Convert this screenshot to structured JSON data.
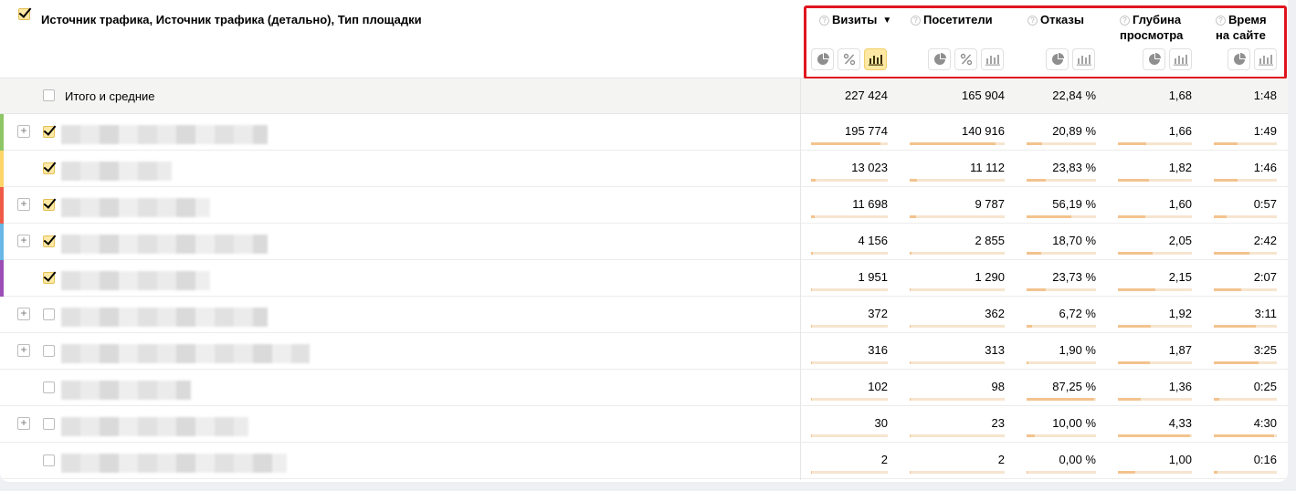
{
  "header": {
    "dimensions_title": "Источник трафика, Источник трафика (детально), Тип площадки",
    "metrics": [
      {
        "name": "Визиты",
        "line2": "",
        "sorted": true,
        "sort_arrow": "▼",
        "buttons": [
          "pie-chart-icon",
          "percent-icon",
          "bar-chart-icon"
        ],
        "active_button": "bar-chart-icon"
      },
      {
        "name": "Посетители",
        "line2": "",
        "sorted": false,
        "buttons": [
          "pie-chart-icon",
          "percent-icon",
          "bar-chart-icon"
        ]
      },
      {
        "name": "Отказы",
        "line2": "",
        "sorted": false,
        "buttons": [
          "pie-chart-icon",
          "bar-chart-icon"
        ]
      },
      {
        "name": "Глубина",
        "line2": "просмотра",
        "sorted": false,
        "buttons": [
          "pie-chart-icon",
          "bar-chart-icon"
        ]
      },
      {
        "name": "Время",
        "line2": "на сайте",
        "sorted": false,
        "buttons": [
          "pie-chart-icon",
          "bar-chart-icon"
        ]
      }
    ],
    "help_glyph": "?"
  },
  "totals": {
    "label": "Итого и средние",
    "values": [
      "227 424",
      "165 904",
      "22,84 %",
      "1,68",
      "1:48"
    ]
  },
  "rows": [
    {
      "color": "#8cc665",
      "expandable": true,
      "checked": true,
      "values": [
        "195 774",
        "140 916",
        "20,89 %",
        "1,66",
        "1:49"
      ],
      "bars": [
        0.9,
        0.9,
        0.22,
        0.38,
        0.38
      ]
    },
    {
      "color": "#fbd567",
      "expandable": false,
      "checked": true,
      "values": [
        "13 023",
        "11 112",
        "23,83 %",
        "1,82",
        "1:46"
      ],
      "bars": [
        0.06,
        0.08,
        0.27,
        0.42,
        0.37
      ]
    },
    {
      "color": "#ef5b46",
      "expandable": true,
      "checked": true,
      "values": [
        "11 698",
        "9 787",
        "56,19 %",
        "1,60",
        "0:57"
      ],
      "bars": [
        0.05,
        0.07,
        0.64,
        0.37,
        0.2
      ]
    },
    {
      "color": "#68b7e6",
      "expandable": true,
      "checked": true,
      "values": [
        "4 156",
        "2 855",
        "18,70 %",
        "2,05",
        "2:42"
      ],
      "bars": [
        0.02,
        0.02,
        0.21,
        0.47,
        0.56
      ]
    },
    {
      "color": "#9b4fb5",
      "expandable": false,
      "checked": true,
      "values": [
        "1 951",
        "1 290",
        "23,73 %",
        "2,15",
        "2:07"
      ],
      "bars": [
        0.01,
        0.01,
        0.27,
        0.5,
        0.44
      ]
    },
    {
      "color": "",
      "expandable": true,
      "checked": false,
      "values": [
        "372",
        "362",
        "6,72 %",
        "1,92",
        "3:11"
      ],
      "bars": [
        0.005,
        0.005,
        0.08,
        0.44,
        0.66
      ]
    },
    {
      "color": "",
      "expandable": true,
      "checked": false,
      "values": [
        "316",
        "313",
        "1,90 %",
        "1,87",
        "3:25"
      ],
      "bars": [
        0.005,
        0.005,
        0.03,
        0.43,
        0.71
      ]
    },
    {
      "color": "",
      "expandable": false,
      "checked": false,
      "values": [
        "102",
        "98",
        "87,25 %",
        "1,36",
        "0:25"
      ],
      "bars": [
        0.003,
        0.003,
        0.98,
        0.31,
        0.09
      ]
    },
    {
      "color": "",
      "expandable": true,
      "checked": false,
      "values": [
        "30",
        "23",
        "10,00 %",
        "4,33",
        "4:30"
      ],
      "bars": [
        0.002,
        0.002,
        0.12,
        0.98,
        0.95
      ]
    },
    {
      "color": "",
      "expandable": false,
      "checked": false,
      "values": [
        "2",
        "2",
        "0,00 %",
        "1,00",
        "0:16"
      ],
      "bars": [
        0.001,
        0.001,
        0.01,
        0.23,
        0.06
      ]
    }
  ],
  "plus_glyph": "+",
  "colors": {
    "accent_yellow": "#fde9a3",
    "bar_fill": "#f3c38e",
    "bar_track": "#f6e5cf",
    "highlight_border": "#e0141e"
  }
}
